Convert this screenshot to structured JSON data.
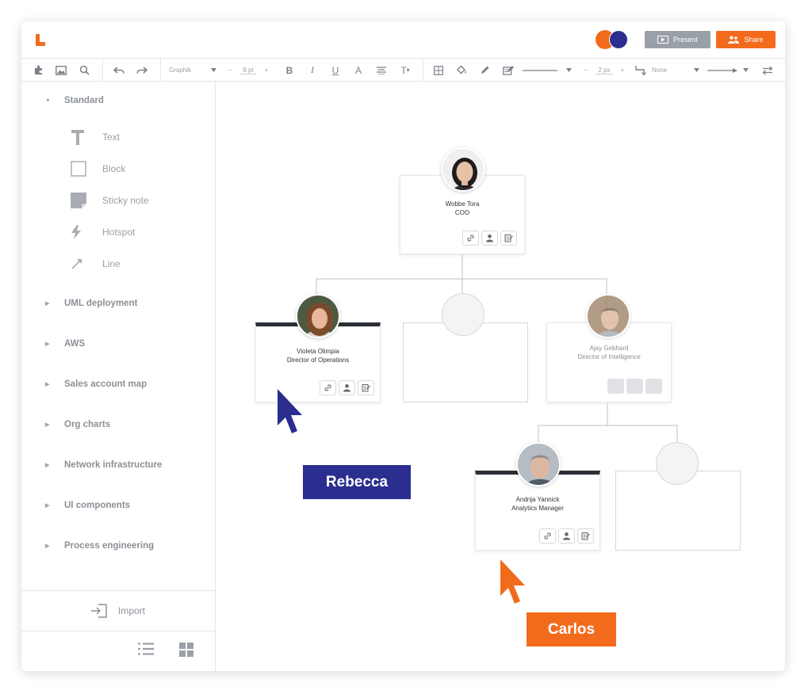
{
  "app": {
    "share_label": "Share",
    "present_label": "Present",
    "collaborator_colors": [
      "#f26b1d",
      "#2b2e8f"
    ],
    "accent": "#f26b1d"
  },
  "toolbar": {
    "font_name": "Graphik",
    "font_size": "8 pt",
    "line_width": "2 px",
    "endpoint": "None"
  },
  "sidebar": {
    "expanded_category": "Standard",
    "shapes": [
      {
        "label": "Text",
        "icon": "text-icon"
      },
      {
        "label": "Block",
        "icon": "block-icon"
      },
      {
        "label": "Sticky note",
        "icon": "sticky-note-icon"
      },
      {
        "label": "Hotspot",
        "icon": "hotspot-icon"
      },
      {
        "label": "Line",
        "icon": "line-icon"
      }
    ],
    "categories": [
      "UML deployment",
      "AWS",
      "Sales account map",
      "Org charts",
      "Network infrastructure",
      "UI components",
      "Process engineering"
    ],
    "import_label": "Import"
  },
  "org_chart": {
    "root": {
      "name": "Wobbe Tora",
      "role": "COO"
    },
    "left": {
      "name": "Violeta Olimpia",
      "role": "Director of Operations"
    },
    "right": {
      "name": "Ajay Gebhard",
      "role": "Director of Intelligence"
    },
    "sub": {
      "name": "Andrija Yannick",
      "role": "Analytics Manager"
    }
  },
  "cursors": [
    {
      "name": "Rebecca",
      "color": "#2b2e8f"
    },
    {
      "name": "Carlos",
      "color": "#f26b1d"
    }
  ]
}
